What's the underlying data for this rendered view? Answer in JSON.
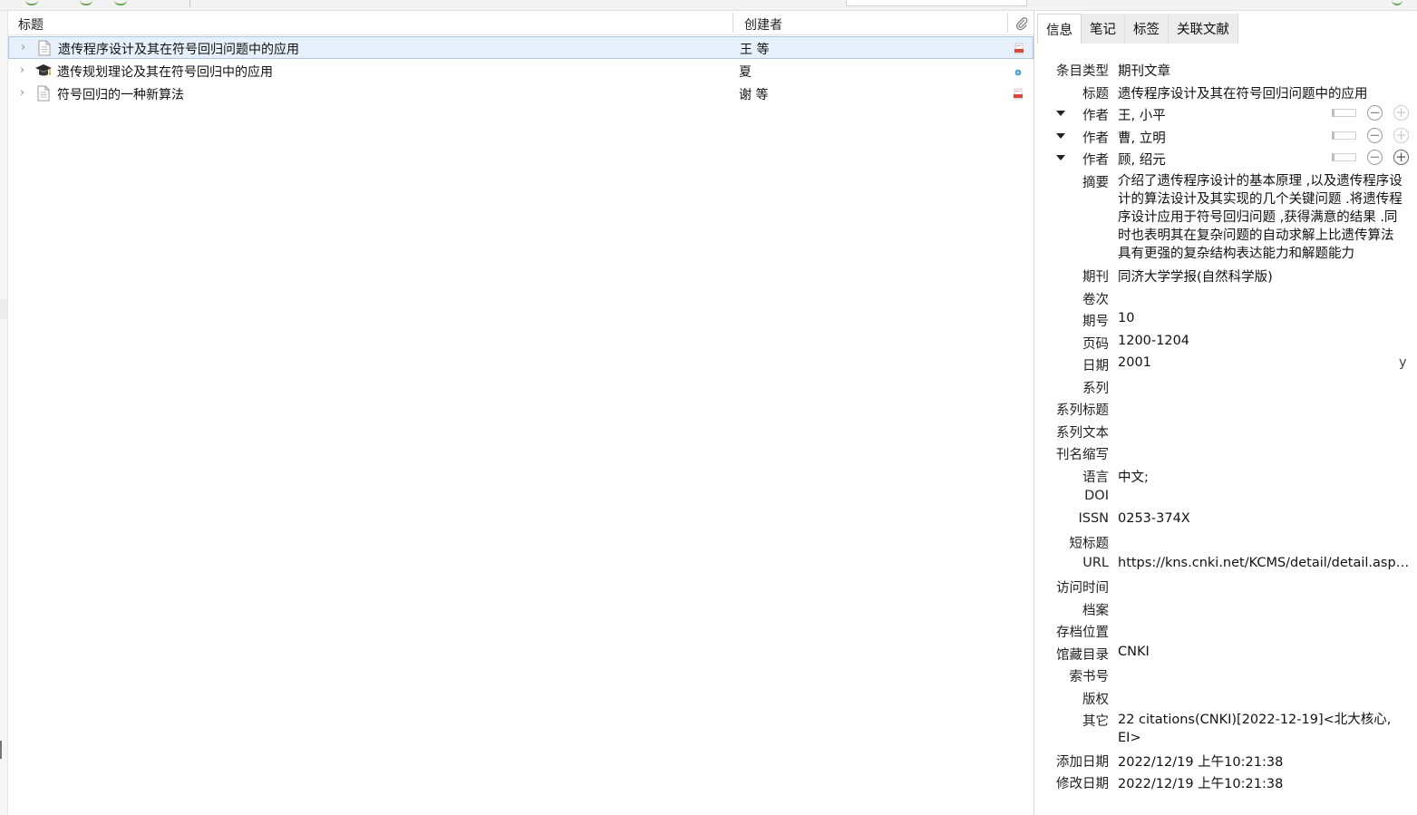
{
  "columns": {
    "title": "标题",
    "creator": "创建者"
  },
  "items": [
    {
      "title": "遗传程序设计及其在符号回归问题中的应用",
      "creator": "王 等",
      "icon": "document-icon",
      "attachment": "pdf-icon",
      "selected": true
    },
    {
      "title": "遗传规划理论及其在符号回归中的应用",
      "creator": "夏",
      "icon": "thesis-cap-icon",
      "attachment": "dot-icon",
      "selected": false
    },
    {
      "title": "符号回归的一种新算法",
      "creator": "谢 等",
      "icon": "document-icon",
      "attachment": "pdf-icon",
      "selected": false
    }
  ],
  "tabs": [
    "信息",
    "笔记",
    "标签",
    "关联文献"
  ],
  "info": {
    "item_type_label": "条目类型",
    "item_type": "期刊文章",
    "title_label": "标题",
    "title": "遗传程序设计及其在符号回归问题中的应用",
    "authors": [
      {
        "label": "作者",
        "name": "王, 小平"
      },
      {
        "label": "作者",
        "name": "曹, 立明"
      },
      {
        "label": "作者",
        "name": "顾, 绍元"
      }
    ],
    "abstract_label": "摘要",
    "abstract": "介绍了遗传程序设计的基本原理 ,以及遗传程序设计的算法设计及其实现的几个关键问题 .将遗传程序设计应用于符号回归问题 ,获得满意的结果 .同时也表明其在复杂问题的自动求解上比遗传算法具有更强的复杂结构表达能力和解题能力",
    "journal_label": "期刊",
    "journal": "同济大学学报(自然科学版)",
    "volume_label": "卷次",
    "volume": "",
    "issue_label": "期号",
    "issue": "10",
    "pages_label": "页码",
    "pages": "1200-1204",
    "date_label": "日期",
    "date": "2001",
    "date_suffix": "y",
    "series_label": "系列",
    "series": "",
    "series_title_label": "系列标题",
    "series_title": "",
    "series_text_label": "系列文本",
    "series_text": "",
    "journal_abbr_label": "刊名缩写",
    "journal_abbr": "",
    "language_label": "语言",
    "language": "中文;",
    "doi_label": "DOI",
    "doi": "",
    "issn_label": "ISSN",
    "issn": "0253-374X",
    "short_title_label": "短标题",
    "short_title": "",
    "url_label": "URL",
    "url": "https://kns.cnki.net/KCMS/detail/detail.aspx?dbcode=CJFQ",
    "accessed_label": "访问时间",
    "accessed": "",
    "archive_label": "档案",
    "archive": "",
    "archive_loc_label": "存档位置",
    "archive_loc": "",
    "library_catalog_label": "馆藏目录",
    "library_catalog": "CNKI",
    "call_number_label": "索书号",
    "call_number": "",
    "rights_label": "版权",
    "rights": "",
    "extra_label": "其它",
    "extra": "22 citations(CNKI)[2022-12-19]<北大核心, EI>",
    "date_added_label": "添加日期",
    "date_added": "2022/12/19 上午10:21:38",
    "date_modified_label": "修改日期",
    "date_modified": "2022/12/19 上午10:21:38"
  }
}
